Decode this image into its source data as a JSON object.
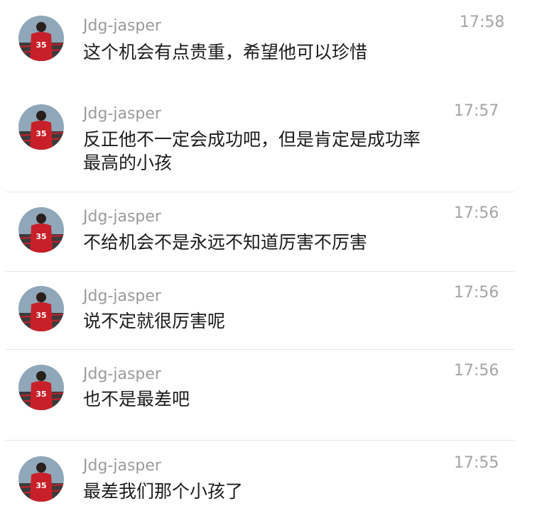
{
  "messages": [
    {
      "sender": "Jdg-jasper",
      "time": "17:58",
      "text": "这个机会有点贵重，希望他可以珍惜"
    },
    {
      "sender": "Jdg-jasper",
      "time": "17:57",
      "text": "反正他不一定会成功吧，但是肯定是成功率最高的小孩"
    },
    {
      "sender": "Jdg-jasper",
      "time": "17:56",
      "text": "不给机会不是永远不知道厉害不厉害"
    },
    {
      "sender": "Jdg-jasper",
      "time": "17:56",
      "text": "说不定就很厉害呢"
    },
    {
      "sender": "Jdg-jasper",
      "time": "17:56",
      "text": "也不是最差吧"
    },
    {
      "sender": "Jdg-jasper",
      "time": "17:55",
      "text": "最差我们那个小孩了"
    }
  ],
  "avatar": {
    "icon": "player-avatar-icon",
    "jersey_number": "35",
    "colors": {
      "jersey": "#c8202a",
      "sky": "#8fa7b8",
      "seats": "#3b3b3b"
    }
  },
  "colors": {
    "name": "#9a9a9a",
    "time": "#a4a4a4",
    "text": "#1c1c1c",
    "divider": "#e6e6e6"
  }
}
